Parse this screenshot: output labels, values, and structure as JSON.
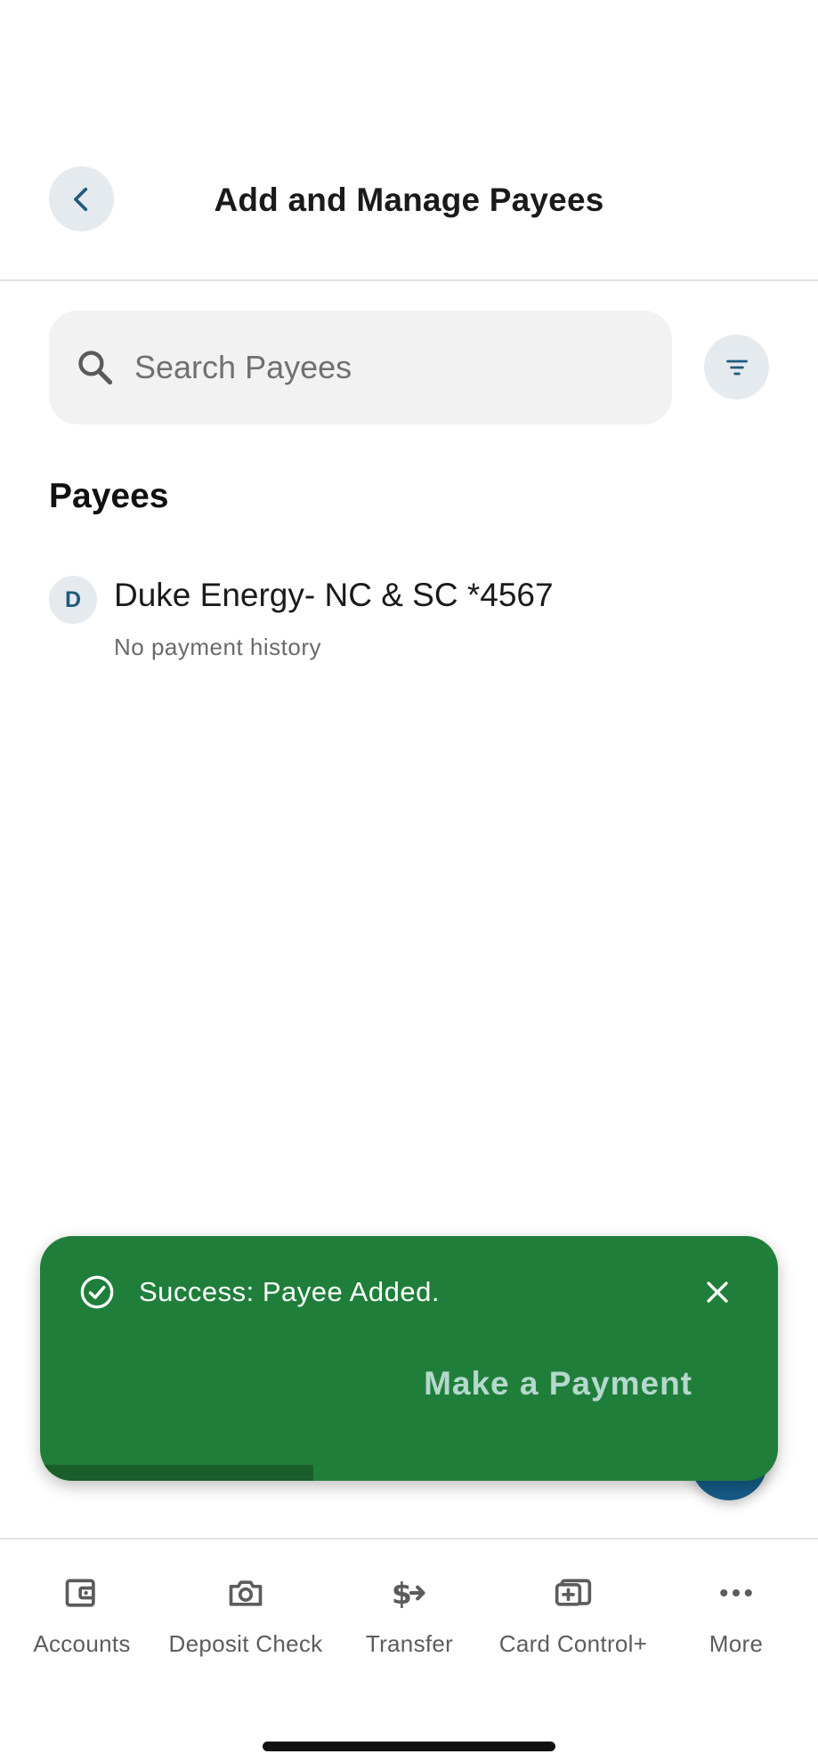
{
  "header": {
    "title": "Add and Manage Payees",
    "back_icon": "chevron-left-icon"
  },
  "search": {
    "placeholder": "Search Payees",
    "value": "",
    "icon": "search-icon"
  },
  "filter": {
    "icon": "filter-icon"
  },
  "payees_section": {
    "title": "Payees",
    "items": [
      {
        "initial": "D",
        "name": "Duke Energy- NC & SC *4567",
        "subtitle": "No payment history"
      }
    ]
  },
  "toast": {
    "message": "Success: Payee Added.",
    "action_label": "Make a Payment",
    "icon": "check-circle-icon",
    "close_icon": "close-icon",
    "progress": 0.37,
    "colors": {
      "background": "#1f7f3a",
      "progress": "#1a5e2b",
      "action": "#b6d8cd"
    }
  },
  "bottom_nav": {
    "items": [
      {
        "label": "Accounts",
        "icon": "wallet-icon"
      },
      {
        "label": "Deposit Check",
        "icon": "camera-icon"
      },
      {
        "label": "Transfer",
        "icon": "dollar-transfer-icon"
      },
      {
        "label": "Card Control+",
        "icon": "card-control-icon"
      },
      {
        "label": "More",
        "icon": "more-dots-icon"
      }
    ]
  },
  "colors": {
    "accent": "#1f5a7d",
    "icon_bg": "#e4eaed",
    "fab": "#165b86"
  }
}
